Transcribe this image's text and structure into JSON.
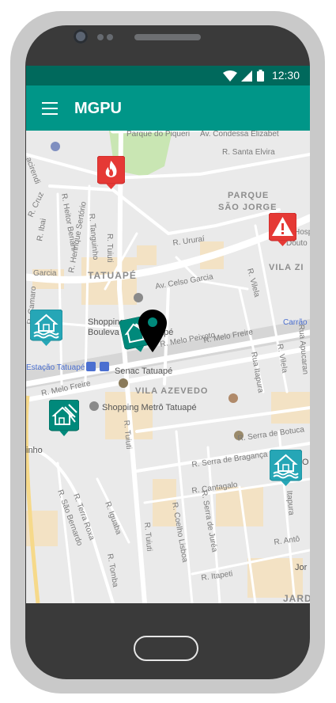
{
  "status_bar": {
    "time": "12:30"
  },
  "app_bar": {
    "title": "MGPU"
  },
  "map": {
    "labels": {
      "parque_piqueri": "Parque do Piqueri",
      "condessa": "Av. Condessa Elizabet",
      "santa_elvira": "R. Santa Elvira",
      "parque": "PARQUE",
      "sao_jorge": "SÃO JORGE",
      "hosp": "Hosp",
      "douto": "Douto",
      "vila_zi": "VILA ZI",
      "tatuape": "TATUAPÉ",
      "celso_garcia": "Av. Celso Garcia",
      "garcia": "Garcia",
      "urura": "R. Ururaí",
      "tuiuti": "R. Tuiuti",
      "tanguinho": "R. Tanguinho",
      "heitor": "R. Heitor Beriani",
      "henrique": "R. Henrique Sertório",
      "camaro": "R. Camaro",
      "cruz": "R. Cruz",
      "ibai": "R. Ibai",
      "acirendi": "acirendi",
      "vilela": "R. Vilela",
      "shopping1": "Shopping",
      "boulevard": "Bouleva",
      "boulevard2": "apé",
      "carrao": "Carrão",
      "melo_peixoto": "R. Melo Peixoto",
      "melo_freire": "R. Melo Freire",
      "melo_freire2": "R. Melo Freire",
      "estacao": "Estação Tatuapé",
      "senac": "Senac Tatuapé",
      "ruaitapura": "Rua Itapura",
      "vilela2": "R. Vilela",
      "apucarana": "Rua Apucaran",
      "vila_azevedo": "VILA AZEVEDO",
      "shopping_metro": "Shopping Metrô Tatuapé",
      "tuiuti2": "R. Tuiuti",
      "serra_botucatu": "R. Serra de Botuca",
      "serra_braganca": "R. Serra de Bragança",
      "cantagalo": "R. Cantagalo",
      "itapura2": "Itapura",
      "inho": "inho",
      "terra_roxa": "R. Terra Roxa",
      "sao_bernardo": "R. São Bernardo",
      "iguaba": "R. Iguaba",
      "coelho_lisboa": "R. Coelho Lisboa",
      "serra_jurea": "R. Serra de Juréa",
      "tuiuti3": "R. Tuiuti",
      "tomba": "R. Tomba",
      "antonio": "R. Antô",
      "itapeti": "R. Itapeti",
      "jard": "JARD",
      "jor": "Jor",
      "o_label": "O"
    },
    "markers": [
      {
        "name": "fire-incident-marker",
        "type": "fire",
        "color": "#e53935"
      },
      {
        "name": "warning-incident-marker",
        "type": "warning",
        "color": "#e53935"
      },
      {
        "name": "flood-house-marker-west",
        "type": "flood",
        "color": "#26a6b6"
      },
      {
        "name": "landslide-marker-center",
        "type": "landslide",
        "color": "#00897b"
      },
      {
        "name": "landslide-marker-southwest",
        "type": "landslide",
        "color": "#00897b"
      },
      {
        "name": "flood-house-marker-east",
        "type": "flood",
        "color": "#26a6b6"
      },
      {
        "name": "current-location-pin",
        "type": "location",
        "color": "#000000"
      }
    ]
  }
}
